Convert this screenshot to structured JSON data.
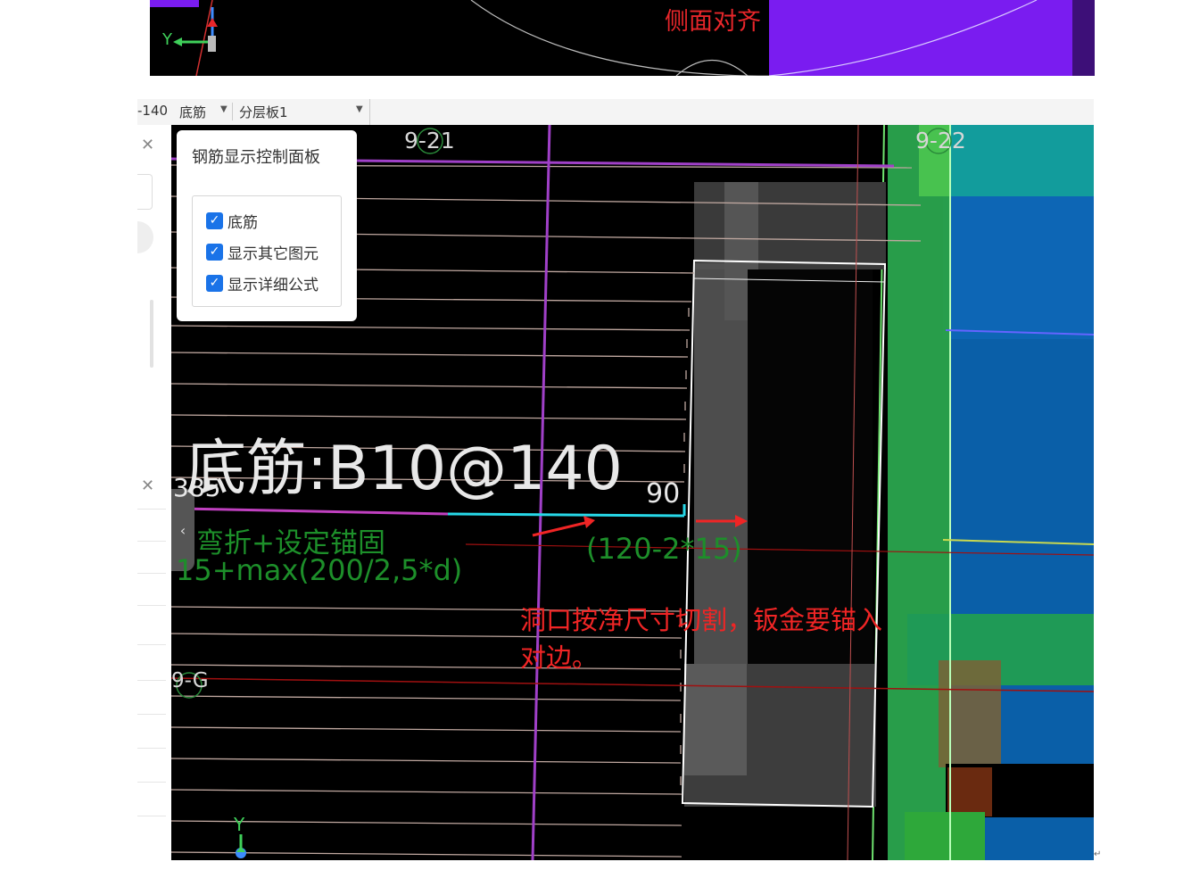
{
  "top_view": {
    "note": "侧面对齐",
    "axis_y": "Y"
  },
  "toolbar": {
    "spacing": "-140",
    "layer_type": "底筋",
    "slab_layer": "分层板1"
  },
  "canvas": {
    "grid_labels": [
      "9-21",
      "9-22",
      "9-G"
    ],
    "control_panel": {
      "title": "钢筋显示控制面板",
      "options": [
        {
          "label": "底筋",
          "checked": true
        },
        {
          "label": "显示其它图元",
          "checked": true
        },
        {
          "label": "显示详细公式",
          "checked": true
        }
      ]
    },
    "rebar_label": "底筋:B10@140",
    "rebar_sub": "90",
    "rebar_length": "385",
    "bend_note": "弯折+设定锚固",
    "formula": "15+max(200/2,5*d)",
    "calc_note": "(120-2*15)",
    "red_note": "洞口按净尺寸切割，钣金要锚入对边。",
    "axis_y": "Y"
  },
  "colors": {
    "annotation_red": "#f02525",
    "formula_green": "#1d8f2a",
    "purple": "#7a1cf0",
    "blue": "#0a5fa8",
    "green_wall": "#2ea83a"
  }
}
